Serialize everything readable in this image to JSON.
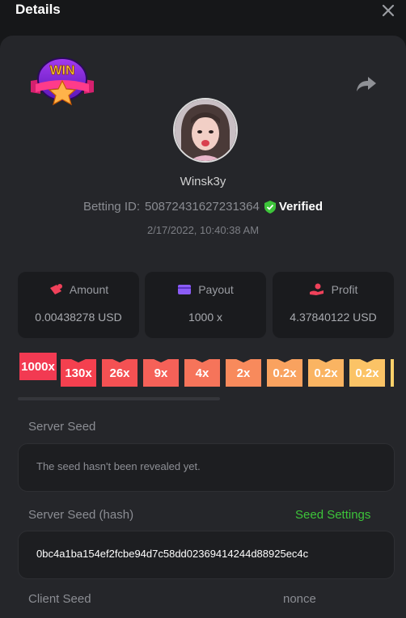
{
  "header": {
    "title": "Details"
  },
  "user": {
    "name": "Winsk3y",
    "betting_id_label": "Betting ID:",
    "betting_id": "50872431627231364",
    "verified_label": "Verified",
    "timestamp": "2/17/2022, 10:40:38 AM"
  },
  "badge": {
    "text": "WIN"
  },
  "stats": [
    {
      "label": "Amount",
      "value": "0.00438278 USD",
      "icon": "coins-icon"
    },
    {
      "label": "Payout",
      "value": "1000 x",
      "icon": "wallet-icon"
    },
    {
      "label": "Profit",
      "value": "4.37840122 USD",
      "icon": "money-hand-icon"
    }
  ],
  "multipliers": [
    {
      "label": "1000x",
      "color": "#f23a52"
    },
    {
      "label": "130x",
      "color": "#f4404f"
    },
    {
      "label": "26x",
      "color": "#f45153"
    },
    {
      "label": "9x",
      "color": "#f56158"
    },
    {
      "label": "4x",
      "color": "#f6745a"
    },
    {
      "label": "2x",
      "color": "#f88a5c"
    },
    {
      "label": "0.2x",
      "color": "#f9a25f"
    },
    {
      "label": "0.2x",
      "color": "#fab462"
    },
    {
      "label": "0.2x",
      "color": "#fbc366"
    }
  ],
  "server_seed": {
    "label": "Server Seed",
    "value": "The seed hasn't been revealed yet."
  },
  "server_seed_hash": {
    "label": "Server Seed (hash)",
    "settings_link": "Seed Settings",
    "value": "0bc4a1ba154ef2fcbe94d7c58dd02369414244d88925ec4c"
  },
  "client_seed": {
    "label": "Client Seed"
  },
  "nonce": {
    "label": "nonce"
  },
  "colors": {
    "accent_green": "#3dc43a",
    "panel": "#25262a",
    "background": "#161719"
  }
}
